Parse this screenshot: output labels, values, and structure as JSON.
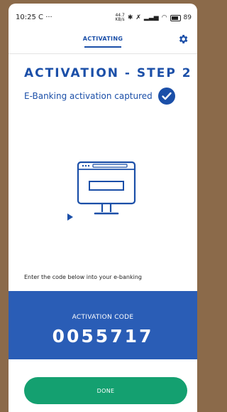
{
  "status_bar": {
    "time": "10:25",
    "sync_glyph": "C",
    "more_glyph": "···",
    "data_speed_top": "44.7",
    "data_speed_bottom": "KB/s",
    "battery": "89"
  },
  "header": {
    "tab_label": "ACTIVATING",
    "settings_icon": "gear-icon"
  },
  "main": {
    "step_title": "ACTIVATION - STEP 2",
    "captured_text": "E-Banking activation captured",
    "captured_icon": "check-circle-icon",
    "illustration_icon": "computer-monitor-icon",
    "instruction": "Enter the code below into your e-banking"
  },
  "code_panel": {
    "label": "ACTIVATION CODE",
    "code": "0055717"
  },
  "footer": {
    "done_label": "DONE"
  },
  "colors": {
    "primary_blue": "#1b4fa8",
    "panel_blue": "#2a5db6",
    "done_green": "#14a070"
  }
}
